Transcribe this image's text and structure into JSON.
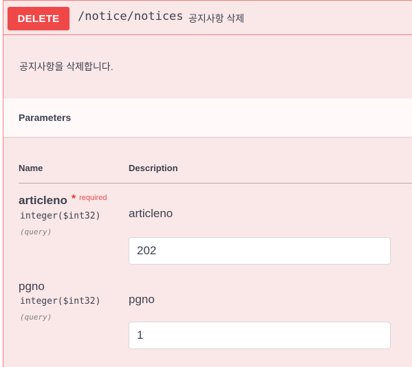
{
  "operation": {
    "method": "DELETE",
    "path": "/notice/notices",
    "summary": "공지사항 삭제",
    "description": "공지사항을 삭제합니다.",
    "colors": {
      "method_bg": "#f04848",
      "block_bg": "#fae7e7",
      "border": "#f27b7b"
    }
  },
  "parameters_section": {
    "title": "Parameters",
    "columns": {
      "name": "Name",
      "description": "Description"
    },
    "items": [
      {
        "name": "articleno",
        "required_star": "*",
        "required_label": "required",
        "type": "integer($int32)",
        "in": "(query)",
        "description": "articleno",
        "value": "202"
      },
      {
        "name": "pgno",
        "type": "integer($int32)",
        "in": "(query)",
        "description": "pgno",
        "value": "1"
      }
    ]
  }
}
